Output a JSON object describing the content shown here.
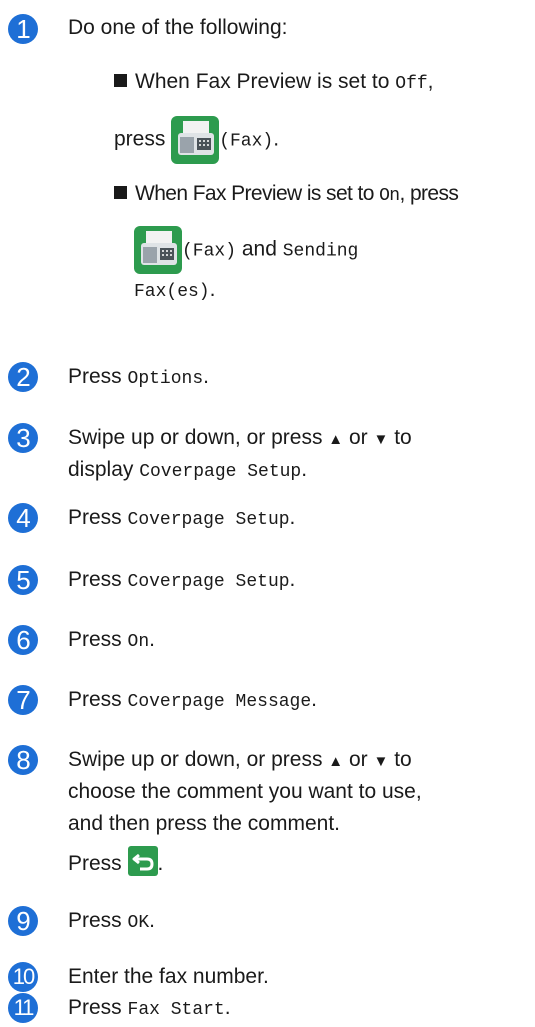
{
  "accent_color": "#1e6fd6",
  "steps": [
    {
      "number": "1",
      "intro": "Do one of the following:",
      "bullets": [
        {
          "t1": "When Fax Preview is set to ",
          "code1": "Off",
          "t2": ",",
          "line2_t": "press ",
          "icon": "fax-icon",
          "code2": "(Fax)",
          "t3": "."
        },
        {
          "t1": "When Fax Preview is set to ",
          "code1": "On",
          "t2": ", press",
          "icon": "fax-icon",
          "code2": "(Fax)",
          "and_text": " and ",
          "code3a": "Sending",
          "code3b": "Fax(es)",
          "t3": "."
        }
      ]
    },
    {
      "number": "2",
      "t1": "Press ",
      "code": "Options",
      "t2": "."
    },
    {
      "number": "3",
      "t1": "Swipe up or down, or press ",
      "up": "▲",
      "or": " or ",
      "down": "▼",
      "t2": " to",
      "line2_t": "display ",
      "code": "Coverpage Setup",
      "t3": "."
    },
    {
      "number": "4",
      "t1": "Press ",
      "code": "Coverpage Setup",
      "t2": "."
    },
    {
      "number": "5",
      "t1": "Press ",
      "code": "Coverpage Setup",
      "t2": "."
    },
    {
      "number": "6",
      "t1": "Press ",
      "code": "On",
      "t2": "."
    },
    {
      "number": "7",
      "t1": "Press ",
      "code": "Coverpage Message",
      "t2": "."
    },
    {
      "number": "8",
      "t1": "Swipe up or down, or press ",
      "up": "▲",
      "or": " or ",
      "down": "▼",
      "t2": " to",
      "line2": "choose the comment you want to use,",
      "line3": "and then press the comment.",
      "line4_t": "Press ",
      "icon": "back-arrow-icon",
      "t3": "."
    },
    {
      "number": "9",
      "t1": "Press ",
      "code": "OK",
      "t2": "."
    },
    {
      "number": "10",
      "text": "Enter the fax number."
    },
    {
      "number": "11",
      "t1": "Press ",
      "code": "Fax Start",
      "t2": "."
    }
  ]
}
